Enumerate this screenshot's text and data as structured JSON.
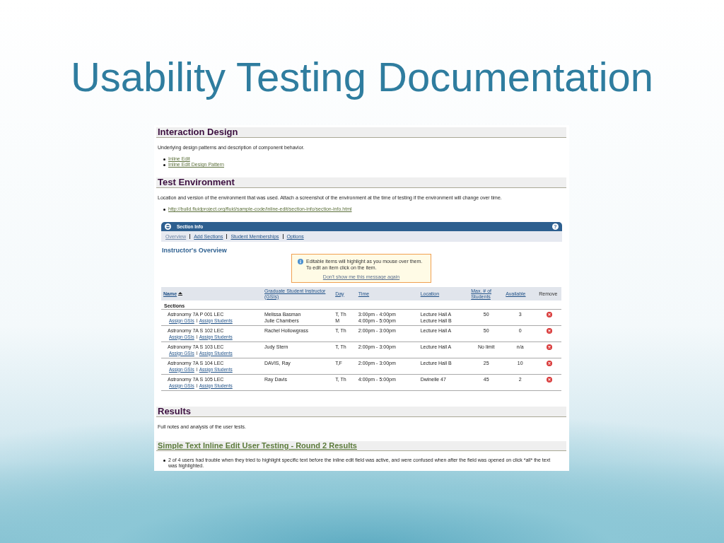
{
  "slide": {
    "title": "Usability Testing Documentation"
  },
  "interaction_design": {
    "heading": "Interaction Design",
    "description": "Underlying design patterns and description of component behavior.",
    "links": [
      "Inline Edit",
      "Inline Edit Design Pattern"
    ]
  },
  "test_environment": {
    "heading": "Test Environment",
    "description": "Location and version of the environment that was used. Attach a screenshot of the environment at the time of testing if the environment will change over time.",
    "links": [
      "http://build.fluidproject.org/fluid/sample-code/inline-edit/section-info/section-info.html"
    ]
  },
  "section_info": {
    "title": "Section Info",
    "help": "?",
    "tabs": [
      {
        "label": "Overview",
        "selected": true
      },
      {
        "label": "Add Sections",
        "selected": false
      },
      {
        "label": "Student Memberships",
        "selected": false
      },
      {
        "label": "Options",
        "selected": false
      }
    ],
    "heading": "Instructor's Overview",
    "notice": {
      "text": "Editable items will highlight as you mouse over them. To edit an item click on the item.",
      "dismiss": "Don't show me this message again"
    },
    "table": {
      "columns": [
        {
          "label": "Name",
          "sortable": true,
          "sorted": true
        },
        {
          "label": "Graduate Student Instructor (GSIs)",
          "sortable": true,
          "sorted": false
        },
        {
          "label": "Day",
          "sortable": true,
          "sorted": false
        },
        {
          "label": "Time",
          "sortable": true,
          "sorted": false
        },
        {
          "label": "Location",
          "sortable": true,
          "sorted": false
        },
        {
          "label": "Max. # of Students",
          "sortable": true,
          "sorted": false
        },
        {
          "label": "Available",
          "sortable": true,
          "sorted": false
        },
        {
          "label": "Remove",
          "sortable": false,
          "sorted": false
        }
      ],
      "group": "Sections",
      "rows": [
        {
          "name": "Astronomy 7A P 001 LEC",
          "actions": [
            "Assign GSIs",
            "Assign Students"
          ],
          "instructors": [
            "Melissa Basman",
            "Julie Chambers"
          ],
          "days": [
            "T, Th",
            "M"
          ],
          "times": [
            "3:00pm - 4:00pm",
            "4:00pm - 5:00pm"
          ],
          "locations": [
            "Lecture Hall A",
            "Lecture Hall B"
          ],
          "max": "50",
          "available": "3"
        },
        {
          "name": "Astronomy 7A S 102 LEC",
          "actions": [
            "Assign GSIs",
            "Assign Students"
          ],
          "instructors": [
            "Rachel Hollowgrass"
          ],
          "days": [
            "T, Th"
          ],
          "times": [
            "2:00pm - 3:00pm"
          ],
          "locations": [
            "Lecture Hall A"
          ],
          "max": "50",
          "available": "0"
        },
        {
          "name": "Astronomy 7A S 103 LEC",
          "actions": [
            "Assign GSIs",
            "Assign Students"
          ],
          "instructors": [
            "Judy Stern"
          ],
          "days": [
            "T, Th"
          ],
          "times": [
            "2:00pm - 3:00pm"
          ],
          "locations": [
            "Lecture Hall A"
          ],
          "max": "No limit",
          "available": "n/a"
        },
        {
          "name": "Astronomy 7A S 104 LEC",
          "actions": [
            "Assign GSIs",
            "Assign Students"
          ],
          "instructors": [
            "DAVIS, Ray"
          ],
          "days": [
            "T,F"
          ],
          "times": [
            "2:00pm - 3:00pm"
          ],
          "locations": [
            "Lecture Hall B"
          ],
          "max": "25",
          "available": "10"
        },
        {
          "name": "Astronomy 7A S 105 LEC",
          "actions": [
            "Assign GSIs",
            "Assign Students"
          ],
          "instructors": [
            "Ray Davis"
          ],
          "days": [
            "T, Th"
          ],
          "times": [
            "4:00pm - 5:00pm"
          ],
          "locations": [
            "Dwinelle 47"
          ],
          "max": "45",
          "available": "2"
        }
      ]
    }
  },
  "results": {
    "heading": "Results",
    "description": "Full notes and analysis of the user tests."
  },
  "round2": {
    "heading": "Simple Text Inline Edit User Testing - Round 2 Results",
    "bullets": [
      "2 of 4 users had trouble when they tried to highlight specific text before the inline edit field was active, and were confused when after the field was opened on click *all* the text was highlighted."
    ]
  }
}
